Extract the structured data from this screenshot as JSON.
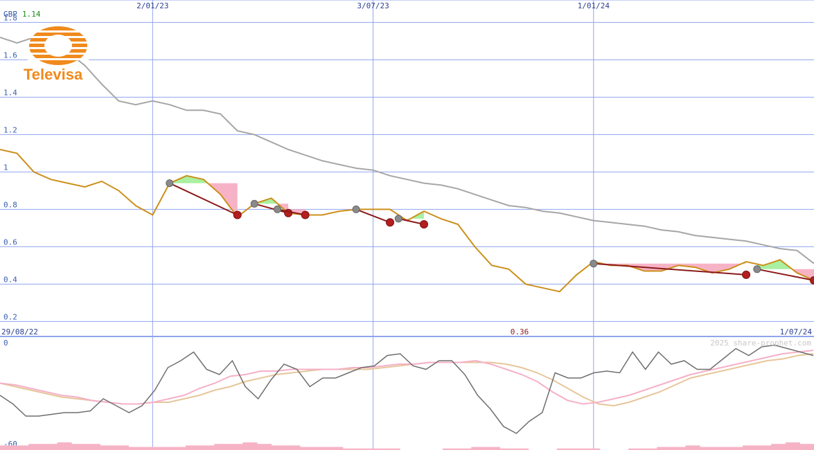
{
  "header": {
    "currency": "GBP",
    "last_price": "1.14"
  },
  "logo": {
    "name": "Televisa"
  },
  "watermark": "2025 share-prophet.com",
  "colors": {
    "grid": "#8fa4ee",
    "price": "#cc8f1a",
    "sma": "#a6a6a6",
    "gain_fill": "#a9f0a0",
    "loss_fill": "#f7b3c6",
    "trend": "#8b1a1a",
    "marker_red": "#b41e1e",
    "marker_gray": "#8a8a8a",
    "osc_main": "#6e6e6e",
    "osc_pink": "#f5b0c8",
    "osc_tan": "#e6c69a",
    "histogram": "#f7b3c6",
    "logo": "#f08a1c"
  },
  "chart_data": [
    {
      "type": "line",
      "title": "",
      "ylabel": "",
      "y_ticks": [
        "1.8",
        "1.6",
        "1.4",
        "1.2",
        "1",
        "0.8",
        "0.6",
        "0.4",
        "0.2"
      ],
      "ylim": [
        0.12,
        1.92
      ],
      "x_labels_top": [
        "2/01/23",
        "3/07/23",
        "1/01/24"
      ],
      "x_labels_bottom": [
        "29/08/22",
        "1/07/24"
      ],
      "xlim": [
        "29/08/22",
        "1/07/24"
      ],
      "series": [
        {
          "key": "price",
          "x": [
            "29/08/22",
            "12/09/22",
            "26/09/22",
            "10/10/22",
            "24/10/22",
            "7/11/22",
            "21/11/22",
            "5/12/22",
            "19/12/22",
            "2/01/23",
            "16/01/23",
            "30/01/23",
            "13/02/23",
            "27/02/23",
            "13/03/23",
            "27/03/23",
            "10/04/23",
            "24/04/23",
            "8/05/23",
            "22/05/23",
            "5/06/23",
            "19/06/23",
            "3/07/23",
            "17/07/23",
            "31/07/23",
            "14/08/23",
            "28/08/23",
            "11/09/23",
            "25/09/23",
            "9/10/23",
            "23/10/23",
            "6/11/23",
            "20/11/23",
            "4/12/23",
            "18/12/23",
            "1/01/24",
            "15/01/24",
            "29/01/24",
            "12/02/24",
            "26/02/24",
            "11/03/24",
            "25/03/24",
            "8/04/24",
            "22/04/24",
            "6/05/24",
            "20/05/24",
            "3/06/24",
            "17/06/24",
            "1/07/24"
          ],
          "values": [
            1.12,
            1.1,
            1.0,
            0.96,
            0.94,
            0.92,
            0.95,
            0.9,
            0.82,
            0.77,
            0.94,
            0.98,
            0.96,
            0.88,
            0.76,
            0.83,
            0.86,
            0.78,
            0.77,
            0.77,
            0.79,
            0.8,
            0.8,
            0.8,
            0.74,
            0.79,
            0.75,
            0.72,
            0.6,
            0.5,
            0.48,
            0.4,
            0.38,
            0.36,
            0.45,
            0.52,
            0.5,
            0.5,
            0.47,
            0.47,
            0.5,
            0.49,
            0.46,
            0.48,
            0.52,
            0.5,
            0.53,
            0.46,
            0.42
          ]
        },
        {
          "key": "sma",
          "x": [
            "29/08/22",
            "12/09/22",
            "26/09/22",
            "10/10/22",
            "24/10/22",
            "7/11/22",
            "21/11/22",
            "5/12/22",
            "19/12/22",
            "2/01/23",
            "16/01/23",
            "30/01/23",
            "13/02/23",
            "27/02/23",
            "13/03/23",
            "27/03/23",
            "10/04/23",
            "24/04/23",
            "8/05/23",
            "22/05/23",
            "5/06/23",
            "19/06/23",
            "3/07/23",
            "17/07/23",
            "31/07/23",
            "14/08/23",
            "28/08/23",
            "11/09/23",
            "25/09/23",
            "9/10/23",
            "23/10/23",
            "6/11/23",
            "20/11/23",
            "4/12/23",
            "18/12/23",
            "1/01/24",
            "15/01/24",
            "29/01/24",
            "12/02/24",
            "26/02/24",
            "11/03/24",
            "25/03/24",
            "8/04/24",
            "22/04/24",
            "6/05/24",
            "20/05/24",
            "3/06/24",
            "17/06/24",
            "1/07/24"
          ],
          "values": [
            1.72,
            1.69,
            1.72,
            1.7,
            1.64,
            1.57,
            1.47,
            1.38,
            1.36,
            1.38,
            1.36,
            1.33,
            1.33,
            1.31,
            1.22,
            1.2,
            1.16,
            1.12,
            1.09,
            1.06,
            1.04,
            1.02,
            1.01,
            0.98,
            0.96,
            0.94,
            0.93,
            0.91,
            0.88,
            0.85,
            0.82,
            0.81,
            0.79,
            0.78,
            0.76,
            0.74,
            0.73,
            0.72,
            0.71,
            0.69,
            0.68,
            0.66,
            0.65,
            0.64,
            0.63,
            0.61,
            0.59,
            0.58,
            0.51
          ]
        }
      ],
      "trend_segments": [
        {
          "from": [
            "16/01/23",
            0.94
          ],
          "to": [
            "13/03/23",
            0.77
          ],
          "outcome": "loss"
        },
        {
          "from": [
            "27/03/23",
            0.83
          ],
          "to": [
            "24/04/23",
            0.78
          ],
          "outcome": "loss"
        },
        {
          "from": [
            "15/04/23",
            0.8
          ],
          "to": [
            "8/05/23",
            0.77
          ],
          "outcome": "loss"
        },
        {
          "from": [
            "19/06/23",
            0.8
          ],
          "to": [
            "17/07/23",
            0.73
          ],
          "outcome": "loss"
        },
        {
          "from": [
            "24/07/23",
            0.75
          ],
          "to": [
            "14/08/23",
            0.72
          ],
          "outcome": "loss"
        },
        {
          "from": [
            "1/01/24",
            0.51
          ],
          "to": [
            "6/05/24",
            0.45
          ],
          "outcome": "loss"
        },
        {
          "from": [
            "15/05/24",
            0.48
          ],
          "to": [
            "1/07/24",
            0.42
          ],
          "outcome": "loss"
        }
      ]
    },
    {
      "type": "line",
      "title": "",
      "y_ticks": [
        "0",
        "-60"
      ],
      "ylim": [
        -60,
        0
      ],
      "current_value_label": "0.36",
      "series": [
        {
          "key": "oscillator",
          "values": [
            -30,
            -35,
            -42,
            -42,
            -41,
            -40,
            -40,
            -39,
            -32,
            -36,
            -40,
            -36,
            -27,
            -14,
            -10,
            -5,
            -15,
            -18,
            -10,
            -25,
            -32,
            -21,
            -12,
            -15,
            -25,
            -20,
            -20,
            -17,
            -14,
            -13,
            -7,
            -6,
            -13,
            -15,
            -10,
            -10,
            -18,
            -30,
            -38,
            -48,
            -52,
            -45,
            -40,
            -17,
            -20,
            -20,
            -17,
            -16,
            -17,
            -5,
            -15,
            -5,
            -12,
            -10,
            -15,
            -15,
            -9,
            -3,
            -7,
            -2,
            -1,
            -3,
            -5,
            -7
          ]
        },
        {
          "key": "signal_fast",
          "values": [
            -23,
            -24,
            -26,
            -28,
            -30,
            -31,
            -33,
            -34,
            -35,
            -35,
            -34,
            -32,
            -30,
            -26,
            -23,
            -19,
            -18,
            -16,
            -16,
            -15,
            -15,
            -15,
            -15,
            -14,
            -14,
            -13,
            -12,
            -12,
            -11,
            -11,
            -11,
            -10,
            -12,
            -15,
            -18,
            -22,
            -28,
            -33,
            -35,
            -34,
            -32,
            -30,
            -27,
            -24,
            -21,
            -18,
            -16,
            -14,
            -12,
            -10,
            -8,
            -6,
            -5,
            -4
          ]
        },
        {
          "key": "signal_slow",
          "values": [
            -23,
            -25,
            -27,
            -29,
            -31,
            -32,
            -33,
            -34,
            -35,
            -35,
            -34,
            -34,
            -32,
            -30,
            -27,
            -25,
            -22,
            -20,
            -18,
            -17,
            -16,
            -15,
            -15,
            -15,
            -15,
            -14,
            -13,
            -12,
            -11,
            -11,
            -11,
            -11,
            -11,
            -12,
            -14,
            -17,
            -21,
            -26,
            -31,
            -35,
            -36,
            -34,
            -31,
            -28,
            -24,
            -20,
            -18,
            -16,
            -14,
            -12,
            -10,
            -9,
            -7,
            -6
          ]
        },
        {
          "key": "histogram",
          "values": [
            3,
            3,
            4,
            4,
            5,
            4,
            4,
            3,
            3,
            2,
            2,
            2,
            2,
            3,
            3,
            4,
            4,
            5,
            4,
            3,
            3,
            2,
            2,
            2,
            1,
            1,
            1,
            1,
            0,
            0,
            0,
            1,
            1,
            2,
            2,
            1,
            1,
            0,
            0,
            1,
            1,
            1,
            0,
            0,
            1,
            1,
            2,
            2,
            3,
            2,
            2,
            2,
            3,
            3,
            4,
            5,
            4
          ]
        }
      ]
    }
  ]
}
